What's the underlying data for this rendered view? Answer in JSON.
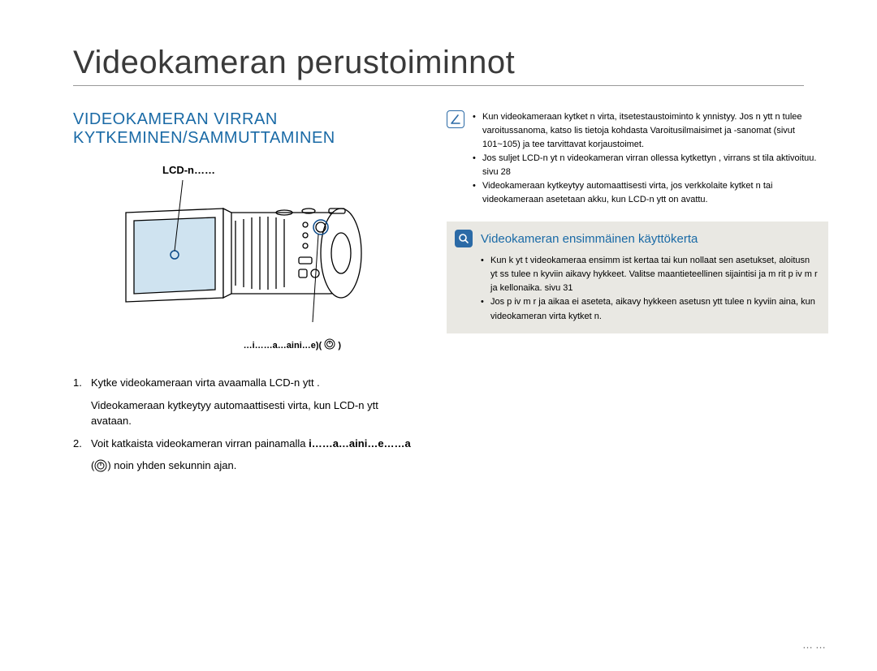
{
  "page_title": "Videokameran perustoiminnot",
  "section_heading": "VIDEOKAMERAN VIRRAN KYTKEMINEN/SAMMUTTAMINEN",
  "lcd_label": "LCD‑n……",
  "power_button_label_prefix": "…i……a…aini…e)(",
  "steps": [
    {
      "num": "1.",
      "text": "Kytke videokameraan virta avaamalla LCD-n ytt .",
      "sub": "Videokameraan kytkeytyy automaattisesti virta, kun LCD-n ytt  avataan."
    },
    {
      "num": "2.",
      "text_before": "Voit katkaista videokameran virran painamalla ",
      "bold": "i……a…aini…e……a",
      "text_after_first": "",
      "text_second_line_before": "(",
      "text_second_line_after": ") noin yhden sekunnin ajan."
    }
  ],
  "info_bullets": [
    "Kun videokameraan kytket  n virta, itsetestaustoiminto k ynnistyy. Jos n ytt  n tulee varoitussanoma, katso lis tietoja kohdasta  Varoitusilmaisimet ja -sanomat  (sivut 101~105) ja tee tarvittavat korjaustoimet.",
    "Jos suljet LCD-n yt n videokameran virran ollessa kytkettyn , virrans  st tila aktivoituu.  sivu 28",
    "Videokameraan kytkeytyy automaattisesti virta, jos verkkolaite kytket  n tai videokameraan asetetaan akku, kun LCD-n ytt  on avattu."
  ],
  "highlight": {
    "title": "Videokameran ensimmäinen käyttökerta",
    "bullets": [
      "Kun k yt t videokameraa ensimm ist  kertaa tai kun nollaat sen asetukset, aloitusn yt ss  tulee n kyviin aikavy hykkeet. Valitse maantieteellinen sijaintisi ja m  rit  p iv m  r  ja kellonaika.  sivu 31",
      "Jos p iv m  r   ja aikaa ei aseteta, aikavy hykkeen asetusn ytt  tulee n kyviin aina, kun videokameran virta kytket  n."
    ]
  },
  "page_number": "……"
}
